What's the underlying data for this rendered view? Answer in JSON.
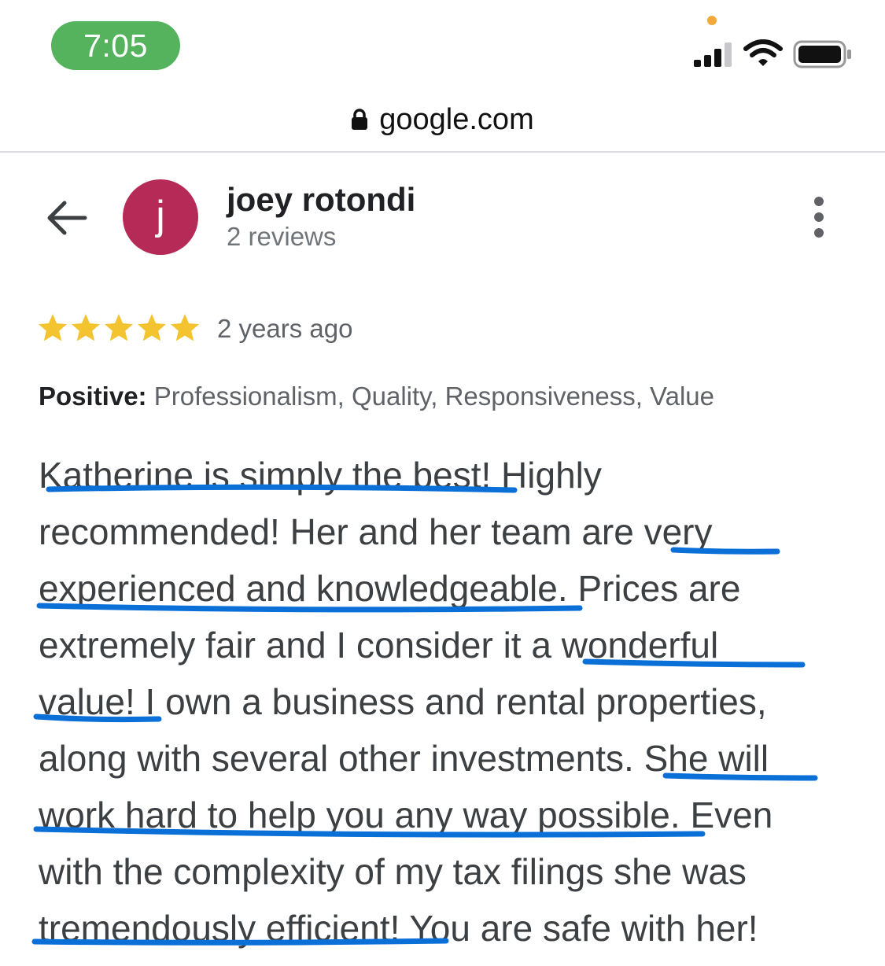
{
  "status_bar": {
    "time": "7:05",
    "time_pill_color": "#55b35e",
    "icons": [
      "privacy-dot",
      "cellular-signal-icon",
      "wifi-icon",
      "battery-icon"
    ]
  },
  "browser": {
    "lock_icon": "lock-icon",
    "url": "google.com"
  },
  "reviewer": {
    "back_icon": "arrow-left-icon",
    "avatar_initial": "j",
    "avatar_color": "#b52a56",
    "name": "joey rotondi",
    "review_count": "2 reviews",
    "more_icon": "more-vert-icon"
  },
  "review": {
    "rating": 5,
    "rating_max": 5,
    "star_color": "#f4c430",
    "date": "2 years ago",
    "positive_label": "Positive:",
    "positive_values": "Professionalism, Quality, Responsiveness, Value",
    "lines": [
      "Katherine is simply the best! Highly",
      "recommended! Her and her team are very",
      "experienced and knowledgeable. Prices are",
      "extremely fair and I consider it a wonderful",
      "value! I own a business and rental properties,",
      "along with several other investments. She will",
      "work hard to help you any way possible. Even",
      "with the complexity of my tax filings she was",
      "tremendously efficient! You are safe with her!"
    ],
    "underline_color": "#0a6fd6"
  }
}
